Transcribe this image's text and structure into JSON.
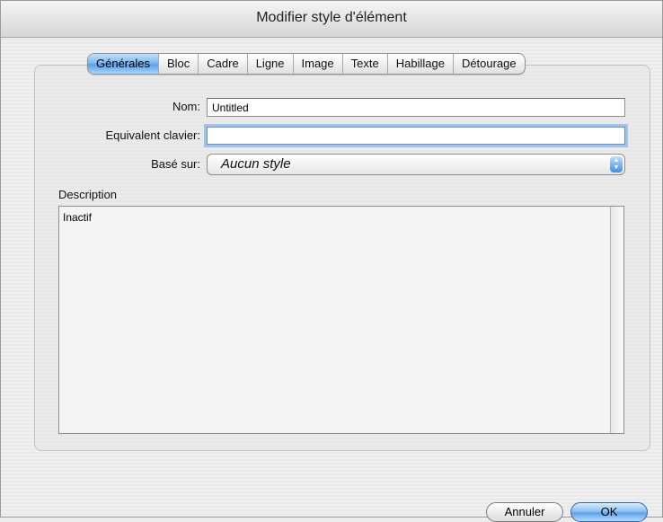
{
  "window": {
    "title": "Modifier style d'élément"
  },
  "tabs": [
    {
      "label": "Générales",
      "active": true
    },
    {
      "label": "Bloc",
      "active": false
    },
    {
      "label": "Cadre",
      "active": false
    },
    {
      "label": "Ligne",
      "active": false
    },
    {
      "label": "Image",
      "active": false
    },
    {
      "label": "Texte",
      "active": false
    },
    {
      "label": "Habillage",
      "active": false
    },
    {
      "label": "Détourage",
      "active": false
    }
  ],
  "form": {
    "name_label": "Nom:",
    "name_value": "Untitled",
    "shortcut_label": "Equivalent clavier:",
    "shortcut_value": "",
    "based_on_label": "Basé sur:",
    "based_on_value": "Aucun style",
    "description_label": "Description",
    "description_value": "Inactif"
  },
  "buttons": {
    "cancel": "Annuler",
    "ok": "OK"
  },
  "colors": {
    "accent": "#5aa2ea",
    "focus_ring": "#9ec3ee"
  }
}
